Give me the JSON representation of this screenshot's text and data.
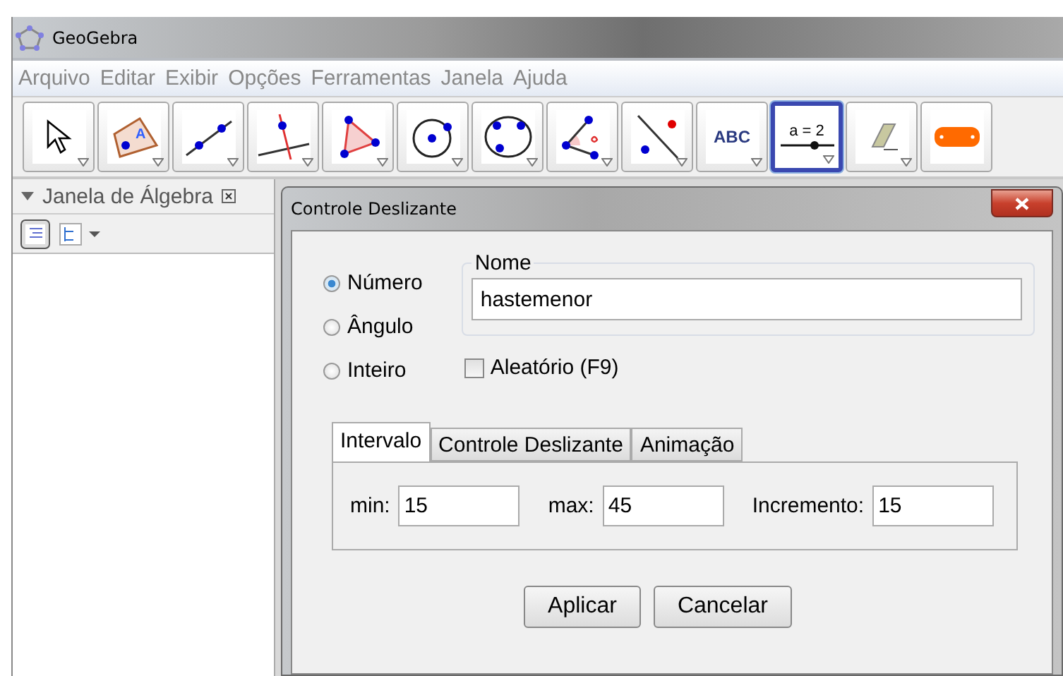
{
  "window": {
    "title": "GeoGebra"
  },
  "menu": [
    "Arquivo",
    "Editar",
    "Exibir",
    "Opções",
    "Ferramentas",
    "Janela",
    "Ajuda"
  ],
  "tools": [
    {
      "kind": "move",
      "selected": false
    },
    {
      "kind": "point",
      "label": "A",
      "selected": false
    },
    {
      "kind": "line",
      "selected": false
    },
    {
      "kind": "perpendicular",
      "selected": false
    },
    {
      "kind": "polygon",
      "selected": false
    },
    {
      "kind": "circle",
      "selected": false
    },
    {
      "kind": "conic",
      "selected": false
    },
    {
      "kind": "angle",
      "selected": false
    },
    {
      "kind": "reflect",
      "selected": false
    },
    {
      "kind": "text",
      "label": "ABC",
      "selected": false
    },
    {
      "kind": "slider",
      "label": "a = 2",
      "selected": true
    },
    {
      "kind": "eraser",
      "selected": false
    },
    {
      "kind": "button",
      "selected": false
    }
  ],
  "algebra_panel": {
    "title": "Janela de Álgebra"
  },
  "dialog": {
    "title": "Controle Deslizante",
    "types": [
      {
        "label": "Número",
        "selected": true
      },
      {
        "label": "Ângulo",
        "selected": false
      },
      {
        "label": "Inteiro",
        "selected": false
      }
    ],
    "name": {
      "legend": "Nome",
      "value": "hastemenor"
    },
    "random": {
      "label": "Aleatório (F9)",
      "checked": false
    },
    "tabs": [
      {
        "label": "Intervalo",
        "selected": true
      },
      {
        "label": "Controle Deslizante",
        "selected": false
      },
      {
        "label": "Animação",
        "selected": false
      }
    ],
    "fields": [
      {
        "label": "min:",
        "value": "15"
      },
      {
        "label": "max:",
        "value": "45"
      },
      {
        "label": "Incremento:",
        "value": "15"
      }
    ],
    "buttons": [
      "Aplicar",
      "Cancelar"
    ]
  }
}
